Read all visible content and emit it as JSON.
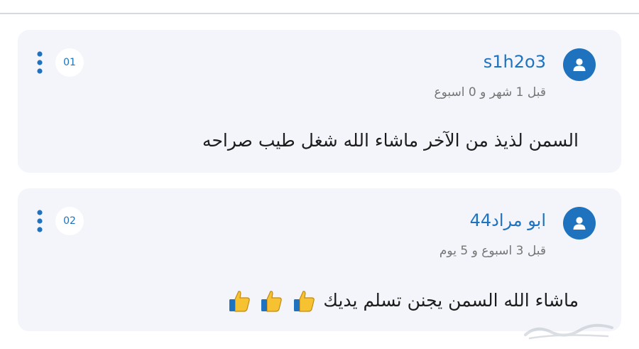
{
  "comments": [
    {
      "number": "01",
      "username": "s1h2o3",
      "timestamp": "قبل 1 شهر و 0 اسبوع",
      "text": "السمن لذيذ من الآخر ماشاء الله شغل طيب صراحه",
      "emoji_count": 0
    },
    {
      "number": "02",
      "username": "ابو مراد44",
      "timestamp": "قبل 3 اسبوع و 5 يوم",
      "text": "ماشاء الله السمن يجنن تسلم يديك",
      "emoji_count": 3
    }
  ],
  "icons": {
    "avatar": "user-icon",
    "menu": "more-vertical-icon",
    "emoji": "thumbs-up-icon"
  },
  "colors": {
    "accent": "#1f73be",
    "card_background": "#f4f5fb",
    "muted_text": "#757575"
  }
}
